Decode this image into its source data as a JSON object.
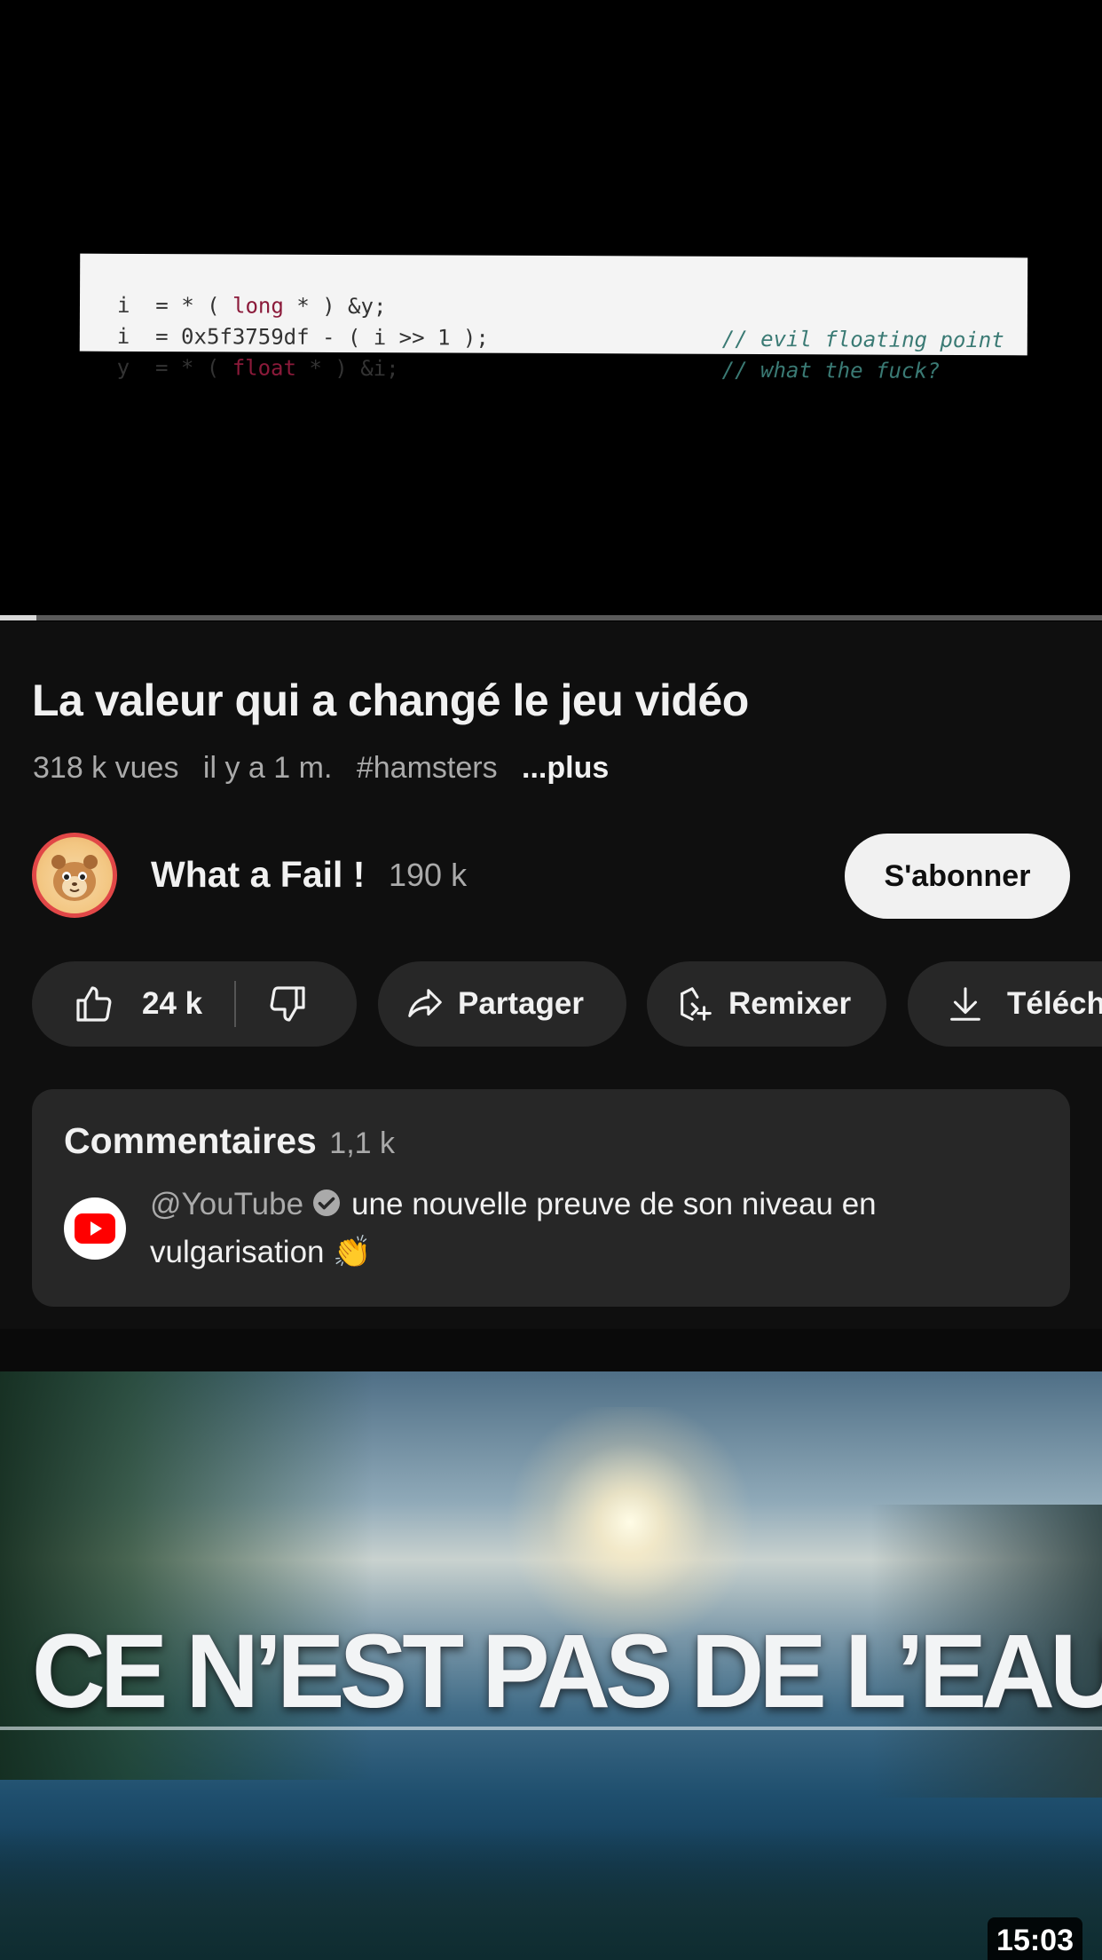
{
  "player": {
    "code_lines": [
      {
        "stmt_pre": "i  = * ( ",
        "keyword": "long",
        "stmt_post": " * ) &y;",
        "comment": "// evil floating point"
      },
      {
        "stmt_pre": "i  = 0x5f3759df - ( i >> 1 );",
        "keyword": "",
        "stmt_post": "",
        "comment": "// what the fuck?"
      },
      {
        "stmt_pre": "y  = * ( ",
        "keyword": "float",
        "stmt_post": " * ) &i;",
        "comment": ""
      }
    ],
    "progress_fraction": 0.033
  },
  "video": {
    "title": "La valeur qui a changé le jeu vidéo",
    "views": "318 k vues",
    "age": "il y a 1 m.",
    "hashtag": "#hamsters",
    "more": "...plus"
  },
  "channel": {
    "name": "What a Fail !",
    "subscribers": "190 k",
    "subscribe_label": "S'abonner"
  },
  "actions": {
    "likes": "24 k",
    "share_label": "Partager",
    "remix_label": "Remixer",
    "download_label": "Téléch"
  },
  "comments": {
    "title": "Commentaires",
    "count": "1,1 k",
    "top_comment": {
      "author": "@YouTube",
      "text": "une nouvelle preuve de son niveau en vulgarisation 👏"
    }
  },
  "next_video": {
    "thumbnail_text": "CE N’EST PAS DE L’EAU",
    "duration": "15:03"
  },
  "colors": {
    "background": "#0f0f0f",
    "pill": "#272727",
    "secondary_text": "#aaaaaa",
    "avatar_ring": "#e14747",
    "youtube_red": "#ff0000"
  }
}
